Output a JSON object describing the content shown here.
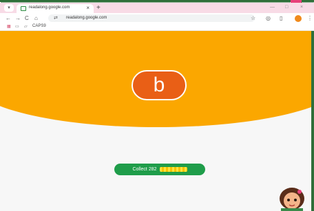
{
  "browser": {
    "tab_title": "readalong.google.com",
    "tab_close": "×",
    "new_tab": "+",
    "window": {
      "minimize": "—",
      "maximize": "□",
      "close": "×"
    },
    "nav": {
      "back": "←",
      "forward": "→",
      "reload": "C",
      "home": "⌂"
    },
    "address": {
      "url": "readalong.google.com"
    },
    "bookmarks": {
      "folder_label": "CAPS9"
    }
  },
  "main": {
    "letter": "b",
    "collect_label": "Collect 282"
  },
  "colors": {
    "hero": "#fba700",
    "badge": "#e95f16",
    "button": "#1f9d4a"
  }
}
